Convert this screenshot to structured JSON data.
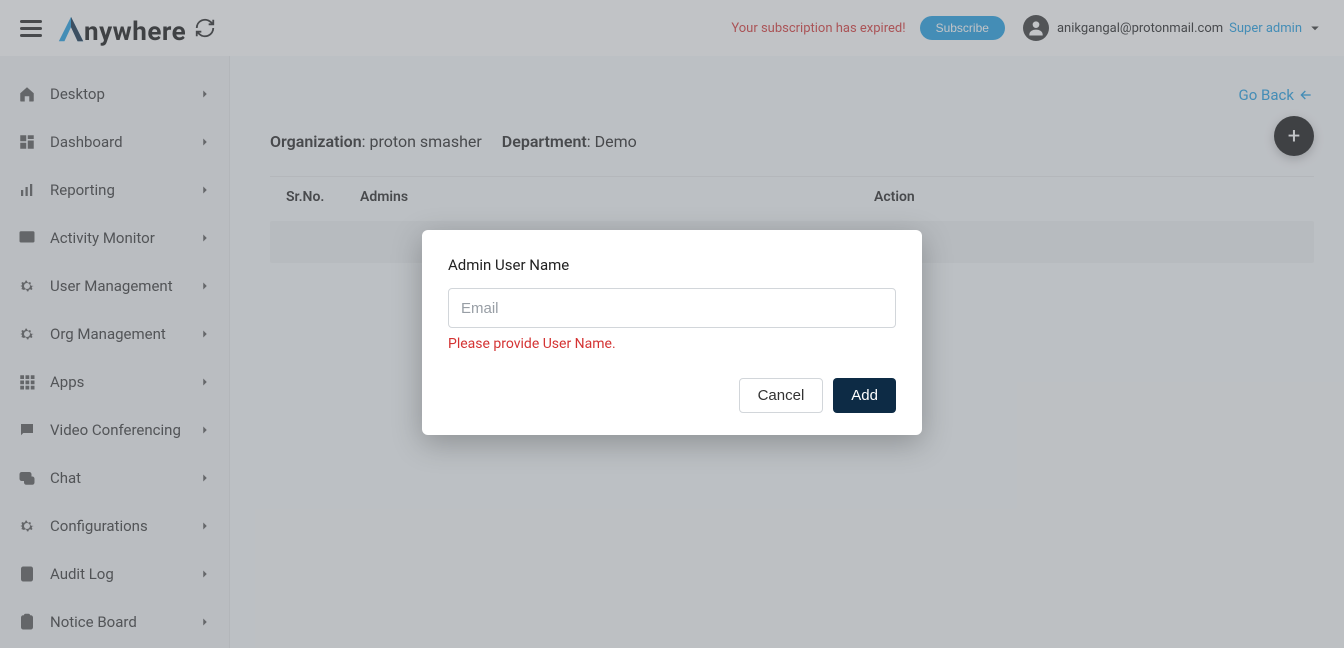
{
  "header": {
    "brand_rest": "nywhere",
    "expired_text": "Your subscription has expired!",
    "subscribe_label": "Subscribe",
    "username": "anikgangal@protonmail.com",
    "role": "Super admin"
  },
  "sidebar": {
    "items": [
      {
        "label": "Desktop"
      },
      {
        "label": "Dashboard"
      },
      {
        "label": "Reporting"
      },
      {
        "label": "Activity Monitor"
      },
      {
        "label": "User Management"
      },
      {
        "label": "Org Management"
      },
      {
        "label": "Apps"
      },
      {
        "label": "Video Conferencing"
      },
      {
        "label": "Chat"
      },
      {
        "label": "Configurations"
      },
      {
        "label": "Audit Log"
      },
      {
        "label": "Notice Board"
      }
    ]
  },
  "main": {
    "go_back": "Go Back",
    "org_label": "Organization",
    "org_value": "proton smasher",
    "dept_label": "Department",
    "dept_value": "Demo",
    "columns": {
      "sr": "Sr.No.",
      "admins": "Admins",
      "action": "Action"
    }
  },
  "modal": {
    "title": "Admin User Name",
    "placeholder": "Email",
    "error": "Please provide User Name.",
    "cancel": "Cancel",
    "add": "Add"
  }
}
